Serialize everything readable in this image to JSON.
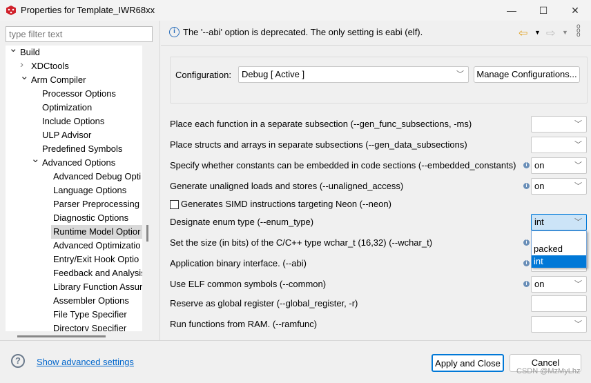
{
  "window": {
    "title": "Properties for Template_IWR68xx",
    "minimize": "—",
    "maximize": "☐",
    "close": "✕"
  },
  "filter": {
    "placeholder": "type filter text"
  },
  "tree": [
    {
      "label": "Build",
      "level": 0,
      "arrow": "down"
    },
    {
      "label": "XDCtools",
      "level": 1,
      "arrow": "right"
    },
    {
      "label": "Arm Compiler",
      "level": 1,
      "arrow": "down"
    },
    {
      "label": "Processor Options",
      "level": 2
    },
    {
      "label": "Optimization",
      "level": 2
    },
    {
      "label": "Include Options",
      "level": 2
    },
    {
      "label": "ULP Advisor",
      "level": 2
    },
    {
      "label": "Predefined Symbols",
      "level": 2
    },
    {
      "label": "Advanced Options",
      "level": 2,
      "arrow": "down"
    },
    {
      "label": "Advanced Debug Opti",
      "level": 3
    },
    {
      "label": "Language Options",
      "level": 3
    },
    {
      "label": "Parser Preprocessing",
      "level": 3
    },
    {
      "label": "Diagnostic Options",
      "level": 3
    },
    {
      "label": "Runtime Model Optior",
      "level": 3,
      "selected": true
    },
    {
      "label": "Advanced Optimizatio",
      "level": 3
    },
    {
      "label": "Entry/Exit Hook Optio",
      "level": 3
    },
    {
      "label": "Feedback and Analysis",
      "level": 3
    },
    {
      "label": "Library Function Assur",
      "level": 3
    },
    {
      "label": "Assembler Options",
      "level": 3
    },
    {
      "label": "File Type Specifier",
      "level": 3
    },
    {
      "label": "Directory Specifier",
      "level": 3
    }
  ],
  "message": "The '--abi' option is deprecated.  The only setting is eabi (elf).",
  "config": {
    "label": "Configuration:",
    "value": "Debug  [ Active ]",
    "manage": "Manage Configurations..."
  },
  "options": [
    {
      "label": "Place each function in a separate subsection (--gen_func_subsections, -ms)",
      "value": "",
      "type": "combo"
    },
    {
      "label": "Place structs and arrays in separate subsections (--gen_data_subsections)",
      "value": "",
      "type": "combo"
    },
    {
      "label": "Specify whether constants can be embedded in code sections (--embedded_constants)",
      "value": "on",
      "type": "combo",
      "info": true
    },
    {
      "label": "Generate unaligned loads and stores (--unaligned_access)",
      "value": "on",
      "type": "combo",
      "info": true
    },
    {
      "label": "Generates SIMD instructions targeting Neon (--neon)",
      "type": "checkbox",
      "checked": false
    },
    {
      "label": "Designate enum type (--enum_type)",
      "value": "int",
      "type": "combo",
      "focused": true
    },
    {
      "label": "Set the size (in bits) of the C/C++ type wchar_t (16,32) (--wchar_t)",
      "value": "",
      "type": "combo",
      "info": true
    },
    {
      "label": "Application binary interface. (--abi)",
      "value": "",
      "type": "combo",
      "info": true
    },
    {
      "label": "Use ELF common symbols (--common)",
      "value": "on",
      "type": "combo",
      "info": true
    },
    {
      "label": "Reserve as global register (--global_register, -r)",
      "value": "",
      "type": "text"
    },
    {
      "label": "Run functions from RAM. (--ramfunc)",
      "value": "",
      "type": "combo"
    }
  ],
  "dropdown": {
    "options": [
      "",
      "packed",
      "int"
    ],
    "highlighted": "int"
  },
  "footer": {
    "advanced": "Show advanced settings",
    "apply": "Apply and Close",
    "cancel": "Cancel",
    "watermark": "CSDN @MzMyLhz"
  },
  "colors": {
    "accent": "#0078d7",
    "link": "#0066cc",
    "app_icon": "#d0202a"
  }
}
